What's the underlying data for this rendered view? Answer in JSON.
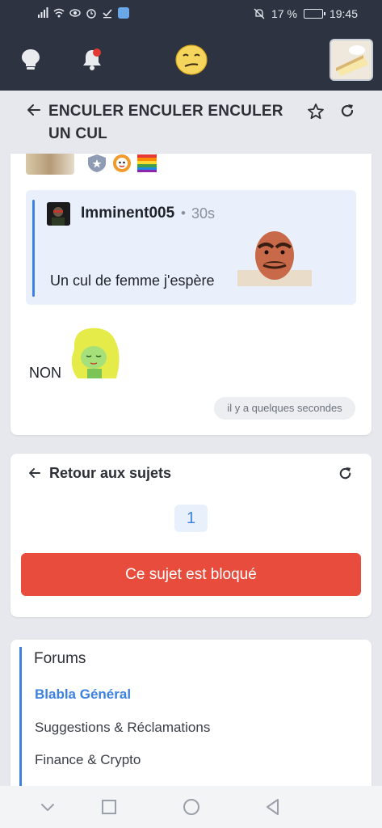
{
  "status_bar": {
    "battery_percent": "17 %",
    "time": "19:45"
  },
  "header": {
    "icons": [
      "lightbulb-icon",
      "bell-icon",
      "smiley-icon",
      "avatar"
    ],
    "notification_dot_color": "#e53935"
  },
  "topic": {
    "title": "ENCULER ENCULER ENCULER UN CUL"
  },
  "quote": {
    "username": "Imminent005",
    "separator": "•",
    "time": "30s",
    "text": "Un cul de femme j'espère"
  },
  "message": {
    "text": "NON",
    "timestamp": "il y a quelques secondes"
  },
  "nav_card": {
    "back_label": "Retour aux sujets",
    "page": "1",
    "blocked_label": "Ce sujet est bloqué"
  },
  "forums": {
    "heading": "Forums",
    "items": [
      {
        "label": "Blabla Général",
        "active": true
      },
      {
        "label": "Suggestions & Réclamations",
        "active": false
      },
      {
        "label": "Finance & Crypto",
        "active": false
      }
    ]
  },
  "colors": {
    "accent": "#3d82e0",
    "danger": "#e84c3d",
    "header_bg": "#2d3340"
  }
}
